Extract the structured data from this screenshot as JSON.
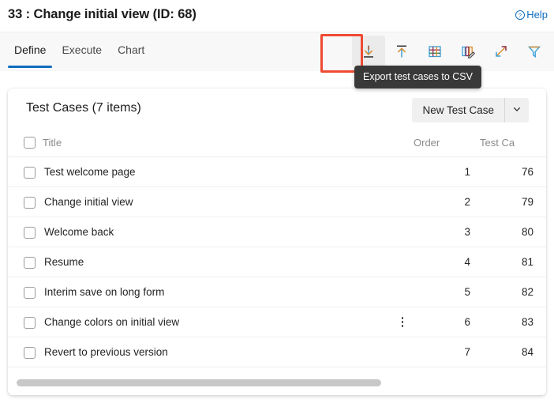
{
  "header": {
    "title": "33 : Change initial view (ID: 68)",
    "help_label": "Help",
    "help_icon": "question-circle-icon"
  },
  "tabs": [
    {
      "label": "Define",
      "active": true
    },
    {
      "label": "Execute",
      "active": false
    },
    {
      "label": "Chart",
      "active": false
    }
  ],
  "toolbar": {
    "buttons": [
      {
        "icon": "export-csv-download-icon",
        "name": "export-test-cases-button",
        "highlighted": true,
        "hovered": true
      },
      {
        "icon": "import-upload-icon",
        "name": "import-test-cases-button",
        "highlighted": false,
        "hovered": false
      },
      {
        "icon": "grid-table-icon",
        "name": "grid-view-button",
        "highlighted": false,
        "hovered": false
      },
      {
        "icon": "edit-columns-icon",
        "name": "edit-columns-button",
        "highlighted": false,
        "hovered": false
      },
      {
        "icon": "expand-diagonal-icon",
        "name": "expand-view-button",
        "highlighted": false,
        "hovered": false
      },
      {
        "icon": "filter-funnel-icon",
        "name": "filter-button",
        "highlighted": false,
        "hovered": false
      }
    ]
  },
  "tooltip": {
    "text": "Export test cases to CSV"
  },
  "card": {
    "title": "Test Cases (7 items)",
    "new_button_label": "New Test Case",
    "new_button_caret_icon": "chevron-down-icon",
    "columns": [
      "Title",
      "Order",
      "Test Ca"
    ],
    "rows": [
      {
        "title": "Test welcome page",
        "order": "1",
        "test_case_id": "76",
        "menu": false
      },
      {
        "title": "Change initial view",
        "order": "2",
        "test_case_id": "79",
        "menu": false
      },
      {
        "title": "Welcome back",
        "order": "3",
        "test_case_id": "80",
        "menu": false
      },
      {
        "title": "Resume",
        "order": "4",
        "test_case_id": "81",
        "menu": false
      },
      {
        "title": "Interim save on long form",
        "order": "5",
        "test_case_id": "82",
        "menu": false
      },
      {
        "title": "Change colors on initial view",
        "order": "6",
        "test_case_id": "83",
        "menu": true
      },
      {
        "title": "Revert to previous version",
        "order": "7",
        "test_case_id": "84",
        "menu": false
      }
    ]
  },
  "colors": {
    "accent": "#0f6cbd",
    "highlight": "#ef4a33",
    "tooltip_bg": "#393939",
    "command_bar_bg": "#f8f8f8",
    "scrollbar_thumb": "#c8c8c8"
  }
}
